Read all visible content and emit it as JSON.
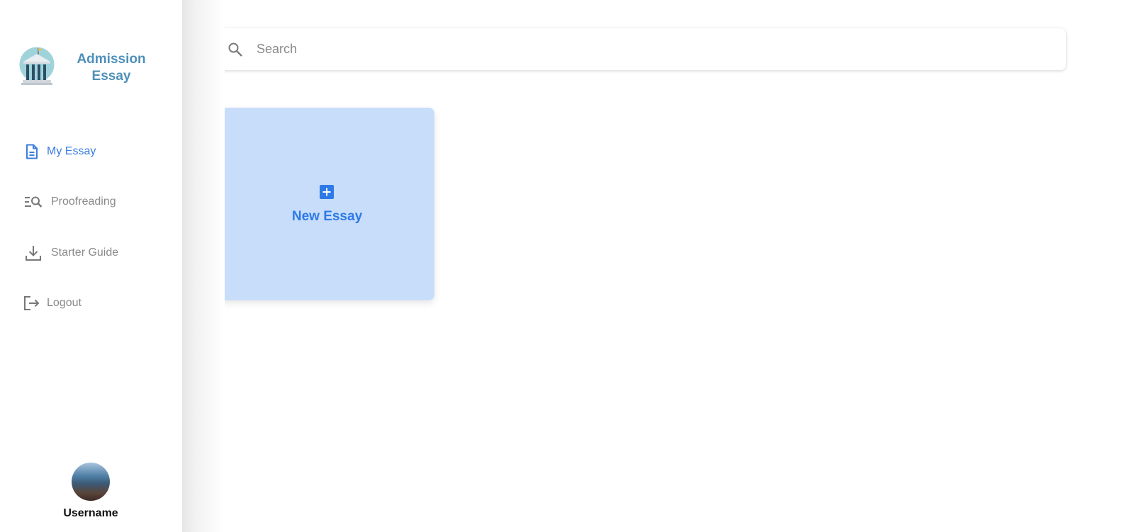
{
  "brand": {
    "name": "Admission Essay",
    "icon": "bank-building-icon"
  },
  "sidebar": {
    "items": [
      {
        "label": "My Essay",
        "icon": "document-icon",
        "active": true
      },
      {
        "label": "Proofreading",
        "icon": "search-list-icon",
        "active": false
      },
      {
        "label": "Starter Guide",
        "icon": "download-icon",
        "active": false
      },
      {
        "label": "Logout",
        "icon": "logout-icon",
        "active": false
      }
    ],
    "user": {
      "name": "Username"
    }
  },
  "search": {
    "placeholder": "Search",
    "value": "",
    "icon": "search-icon"
  },
  "main": {
    "new_card": {
      "label": "New Essay",
      "icon": "plus-square-icon"
    }
  },
  "colors": {
    "brand": "#4e90b9",
    "accent": "#3b7ddd",
    "card_bg": "#c8ddfa",
    "card_text": "#2d7ae6",
    "nav_inactive": "#8a8a8a"
  }
}
